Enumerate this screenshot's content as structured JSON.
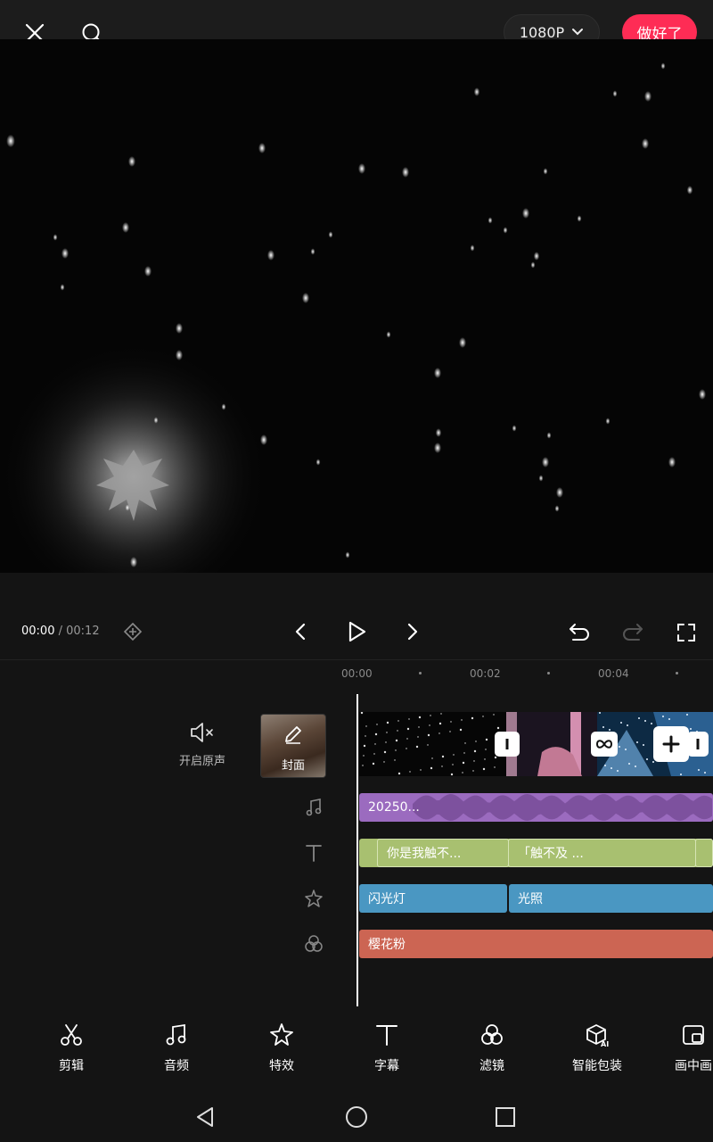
{
  "top": {
    "resolution": "1080P",
    "done_label": "做好了"
  },
  "playback": {
    "current_time": "00:00",
    "separator": " / ",
    "total_time": "00:12"
  },
  "ruler": {
    "labels": [
      "00:00",
      "00:02",
      "00:04"
    ]
  },
  "left_panel": {
    "original_sound_label": "开启原声",
    "cover_label": "封面"
  },
  "tracks": {
    "audio_clip": "20250...",
    "text_clip_1": "你是我触不...",
    "text_clip_2": "「触不及 ...",
    "effect_clip_1": "闪光灯",
    "effect_clip_2": "光照",
    "filter_clip": "樱花粉"
  },
  "toolbar": {
    "items": [
      {
        "label": "剪辑",
        "icon": "scissors-icon"
      },
      {
        "label": "音频",
        "icon": "music-note-icon"
      },
      {
        "label": "特效",
        "icon": "sparkle-star-icon"
      },
      {
        "label": "字幕",
        "icon": "text-t-icon"
      },
      {
        "label": "滤镜",
        "icon": "filter-circles-icon"
      },
      {
        "label": "智能包装",
        "icon": "ai-box-icon"
      },
      {
        "label": "画中画",
        "icon": "picture-in-picture-icon"
      }
    ]
  },
  "colors": {
    "accent": "#fe2c55",
    "audio_track": "#9b6bbf",
    "text_track": "#a8c070",
    "effect_track": "#4a97c2",
    "filter_track": "#cc6553"
  }
}
